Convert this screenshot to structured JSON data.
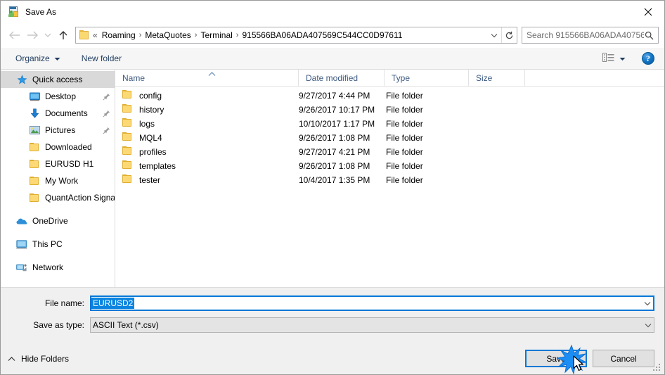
{
  "window": {
    "title": "Save As",
    "icon": "save-as-icon",
    "close_label": "✕"
  },
  "nav": {
    "back_icon": "arrow-left-icon",
    "forward_icon": "arrow-right-icon",
    "recent_icon": "chevron-down-icon",
    "up_icon": "arrow-up-icon",
    "address": {
      "folder_icon": "folder-icon",
      "prefix": "«",
      "crumbs": [
        "Roaming",
        "MetaQuotes",
        "Terminal",
        "915566BA06ADA407569C544CC0D97611"
      ],
      "separator": "›",
      "dropdown_icon": "chevron-down-icon",
      "refresh_icon": "refresh-icon"
    },
    "search": {
      "placeholder": "Search 915566BA06ADA40756...",
      "icon": "search-icon"
    }
  },
  "toolbar": {
    "organize_label": "Organize",
    "organize_caret": "▾",
    "new_folder_label": "New folder",
    "view_icon": "list-view-icon",
    "view_caret": "▾",
    "help_label": "?",
    "help_icon": "help-icon"
  },
  "sidebar": {
    "items": [
      {
        "label": "Quick access",
        "icon": "star-icon",
        "indent": "root",
        "selected": true,
        "pinned": false,
        "group": false
      },
      {
        "label": "Desktop",
        "icon": "monitor-icon",
        "indent": "1",
        "selected": false,
        "pinned": true,
        "group": false
      },
      {
        "label": "Documents",
        "icon": "download-icon",
        "indent": "1",
        "selected": false,
        "pinned": true,
        "group": false
      },
      {
        "label": "Pictures",
        "icon": "picture-icon",
        "indent": "1",
        "selected": false,
        "pinned": true,
        "group": false
      },
      {
        "label": "Downloaded",
        "icon": "folder-icon",
        "indent": "1",
        "selected": false,
        "pinned": false,
        "group": false
      },
      {
        "label": "EURUSD H1",
        "icon": "folder-icon",
        "indent": "1",
        "selected": false,
        "pinned": false,
        "group": false
      },
      {
        "label": "My Work",
        "icon": "folder-icon",
        "indent": "1",
        "selected": false,
        "pinned": false,
        "group": false
      },
      {
        "label": "QuantAction Signal",
        "icon": "folder-icon",
        "indent": "1",
        "selected": false,
        "pinned": false,
        "group": false
      },
      {
        "label": "OneDrive",
        "icon": "cloud-icon",
        "indent": "root",
        "selected": false,
        "pinned": false,
        "group": true
      },
      {
        "label": "This PC",
        "icon": "pc-icon",
        "indent": "root",
        "selected": false,
        "pinned": false,
        "group": true
      },
      {
        "label": "Network",
        "icon": "network-icon",
        "indent": "root",
        "selected": false,
        "pinned": false,
        "group": true
      }
    ]
  },
  "filelist": {
    "columns": [
      {
        "key": "name",
        "label": "Name",
        "sorted": true,
        "sort_dir": "asc"
      },
      {
        "key": "date",
        "label": "Date modified",
        "sorted": false
      },
      {
        "key": "type",
        "label": "Type",
        "sorted": false
      },
      {
        "key": "size",
        "label": "Size",
        "sorted": false
      }
    ],
    "rows": [
      {
        "name": "config",
        "date": "9/27/2017 4:44 PM",
        "type": "File folder",
        "size": "",
        "icon": "folder-icon"
      },
      {
        "name": "history",
        "date": "9/26/2017 10:17 PM",
        "type": "File folder",
        "size": "",
        "icon": "folder-icon"
      },
      {
        "name": "logs",
        "date": "10/10/2017 1:17 PM",
        "type": "File folder",
        "size": "",
        "icon": "folder-icon"
      },
      {
        "name": "MQL4",
        "date": "9/26/2017 1:08 PM",
        "type": "File folder",
        "size": "",
        "icon": "folder-icon"
      },
      {
        "name": "profiles",
        "date": "9/27/2017 4:21 PM",
        "type": "File folder",
        "size": "",
        "icon": "folder-icon"
      },
      {
        "name": "templates",
        "date": "9/26/2017 1:08 PM",
        "type": "File folder",
        "size": "",
        "icon": "folder-icon"
      },
      {
        "name": "tester",
        "date": "10/4/2017 1:35 PM",
        "type": "File folder",
        "size": "",
        "icon": "folder-icon"
      }
    ]
  },
  "form": {
    "filename_label": "File name:",
    "filename_value": "EURUSD2",
    "filename_selected": true,
    "savetype_label": "Save as type:",
    "savetype_value": "ASCII Text (*.csv)",
    "dropdown_icon": "chevron-down-icon"
  },
  "footer": {
    "hide_folders_label": "Hide Folders",
    "hide_folders_icon": "chevron-up-icon",
    "save_label": "Save",
    "cancel_label": "Cancel",
    "click_effect": "click-burst",
    "cursor": "mouse-pointer"
  },
  "colors": {
    "accent": "#0078d7",
    "selection": "#0a84e0",
    "sidebar_selected": "#d9d9d9",
    "folder": "#fcd975",
    "header_text": "#3d5a80",
    "chrome": "#f0f0f0"
  }
}
